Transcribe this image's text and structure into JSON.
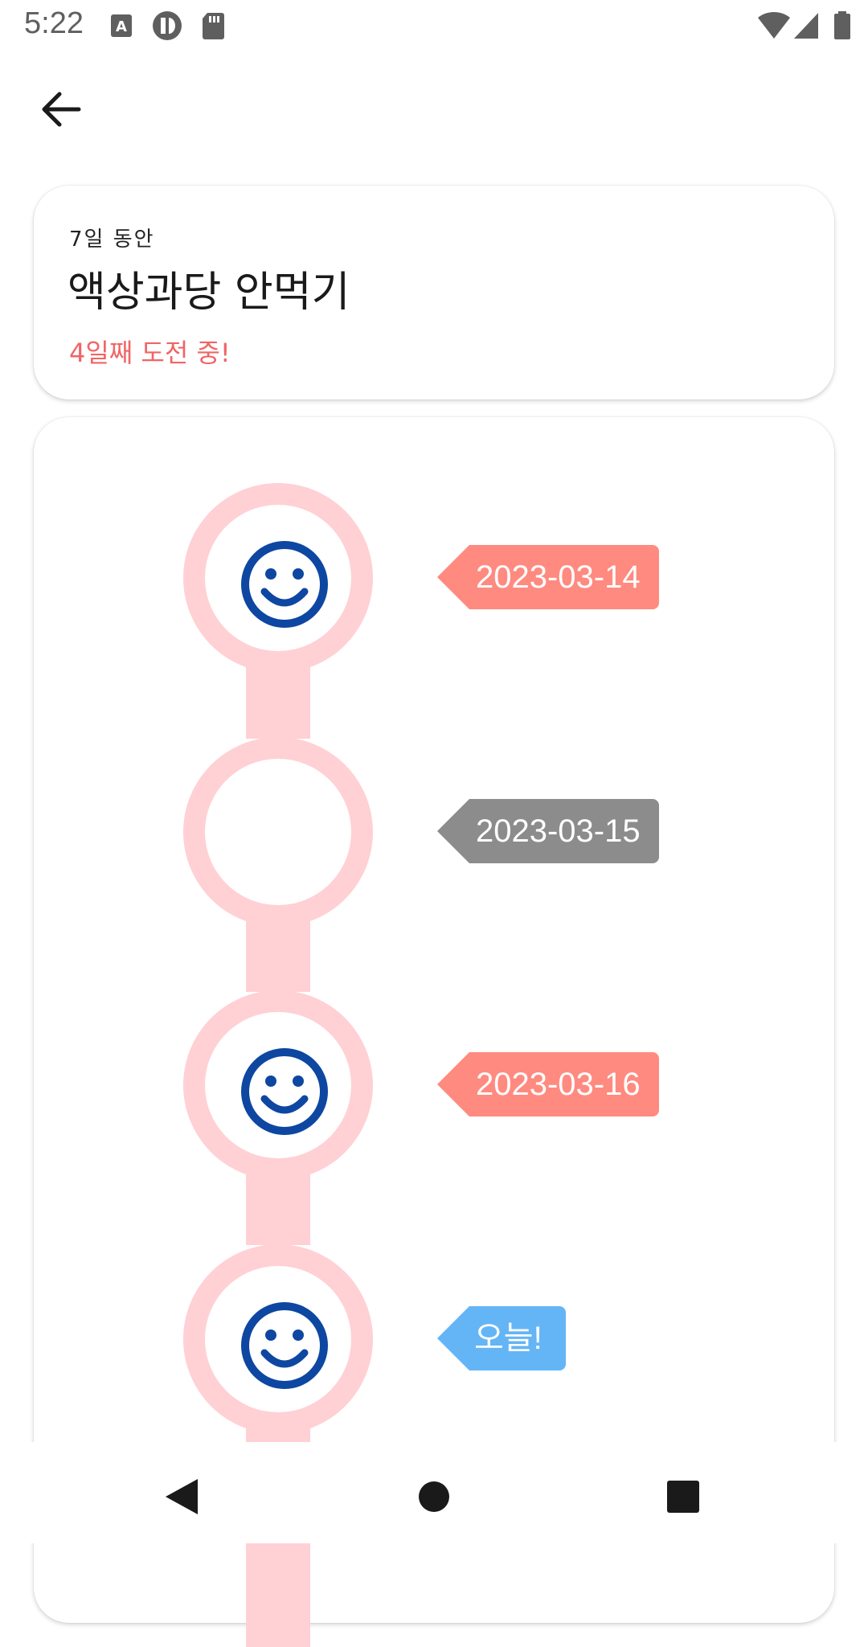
{
  "status_bar": {
    "time": "5:22",
    "icons": [
      "keyboard-a-icon",
      "app-notification-icon",
      "sd-card-icon",
      "wifi-icon",
      "signal-icon",
      "battery-icon"
    ]
  },
  "header": {
    "back_icon": "arrow-back-icon"
  },
  "challenge": {
    "duration": "7일 동안",
    "title": "액상과당 안먹기",
    "status": "4일째 도전 중!"
  },
  "timeline": {
    "entries": [
      {
        "label": "2023-03-14",
        "success": true,
        "tag_color": "#ff8a80"
      },
      {
        "label": "2023-03-15",
        "success": false,
        "tag_color": "#8c8c8c"
      },
      {
        "label": "2023-03-16",
        "success": true,
        "tag_color": "#ff8a80"
      },
      {
        "label": "오늘!",
        "success": true,
        "tag_color": "#64b5f6"
      }
    ]
  },
  "colors": {
    "accent": "#f06565",
    "ring": "#ffd0d4",
    "smiley": "#0d47a1"
  },
  "nav_bar": {
    "icons": [
      "back-triangle-icon",
      "home-circle-icon",
      "recents-square-icon"
    ]
  }
}
